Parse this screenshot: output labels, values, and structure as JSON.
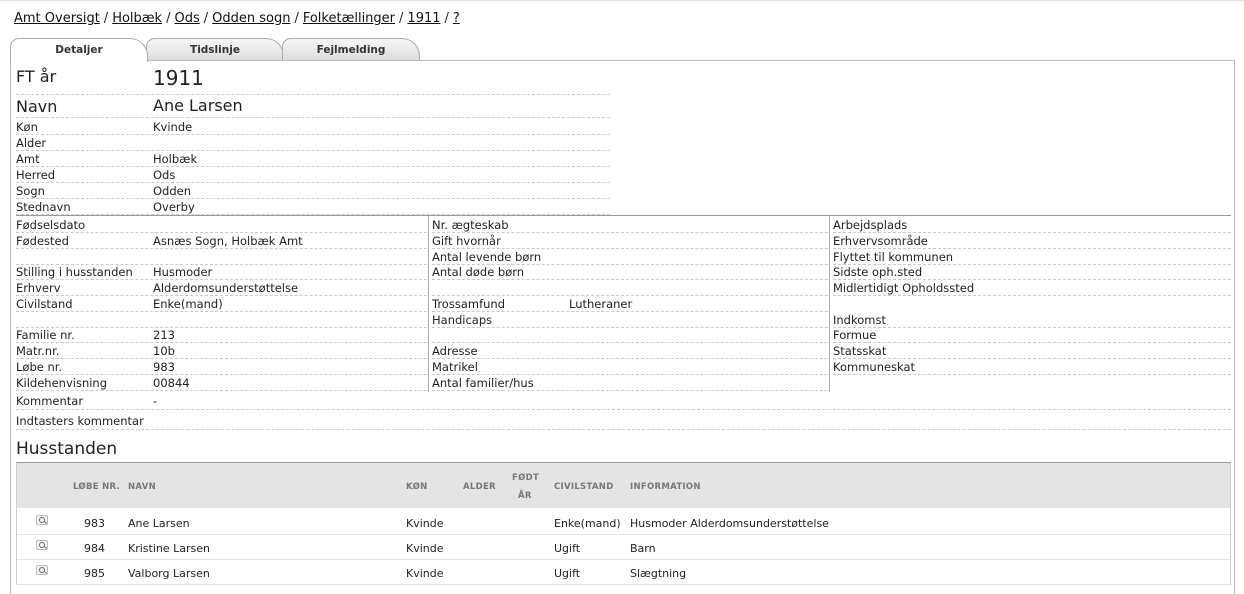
{
  "breadcrumb": {
    "items": [
      "Amt Oversigt",
      "Holbæk",
      "Ods",
      "Odden sogn",
      "Folketællinger",
      "1911",
      "?"
    ]
  },
  "tabs": [
    "Detaljer",
    "Tidslinje",
    "Fejlmelding"
  ],
  "top": {
    "ft_label": "FT år",
    "ft_value": "1911",
    "name_label": "Navn",
    "name_value": "Ane Larsen",
    "rows": [
      {
        "label": "Køn",
        "value": "Kvinde"
      },
      {
        "label": "Alder",
        "value": ""
      },
      {
        "label": "Amt",
        "value": "Holbæk"
      },
      {
        "label": "Herred",
        "value": "Ods"
      },
      {
        "label": "Sogn",
        "value": "Odden"
      },
      {
        "label": "Stednavn",
        "value": "Overby"
      }
    ]
  },
  "col1": [
    {
      "label": "Fødselsdato",
      "value": ""
    },
    {
      "label": "Fødested",
      "value": "Asnæs Sogn, Holbæk Amt"
    },
    {
      "label": "",
      "value": ""
    },
    {
      "label": "Stilling i husstanden",
      "value": "Husmoder"
    },
    {
      "label": "Erhverv",
      "value": "Alderdomsunderstøttelse"
    },
    {
      "label": "Civilstand",
      "value": "Enke(mand)"
    },
    {
      "label": "",
      "value": ""
    },
    {
      "label": "Familie nr.",
      "value": "213"
    },
    {
      "label": "Matr.nr.",
      "value": "10b"
    },
    {
      "label": "Løbe nr.",
      "value": "983"
    },
    {
      "label": "Kildehenvisning",
      "value": "00844"
    }
  ],
  "col2": [
    {
      "label": "Nr. ægteskab",
      "value": ""
    },
    {
      "label": "Gift hvornår",
      "value": ""
    },
    {
      "label": "Antal levende børn",
      "value": ""
    },
    {
      "label": "Antal døde børn",
      "value": ""
    },
    {
      "label": "",
      "value": ""
    },
    {
      "label": "Trossamfund",
      "value": "Lutheraner"
    },
    {
      "label": "Handicaps",
      "value": ""
    },
    {
      "label": "",
      "value": ""
    },
    {
      "label": "Adresse",
      "value": ""
    },
    {
      "label": "Matrikel",
      "value": ""
    },
    {
      "label": "Antal familier/hus",
      "value": ""
    }
  ],
  "col3": [
    {
      "label": "Arbejdsplads"
    },
    {
      "label": "Erhvervsområde"
    },
    {
      "label": "Flyttet til kommunen"
    },
    {
      "label": "Sidste oph.sted"
    },
    {
      "label": "Midlertidigt Opholdssted"
    },
    {
      "label": "Indkomst"
    },
    {
      "label": "Formue"
    },
    {
      "label": "Statsskat"
    },
    {
      "label": "Kommuneskat"
    }
  ],
  "comment": {
    "label": "Kommentar",
    "value": "-"
  },
  "indtaster": {
    "label": "Indtasters kommentar"
  },
  "household": {
    "title": "Husstanden",
    "headers": {
      "lobe": "LØBE NR.",
      "navn": "NAVN",
      "kon": "KØN",
      "alder": "ALDER",
      "fodt1": "FØDT",
      "fodt2": "ÅR",
      "civil": "CIVILSTAND",
      "info": "INFORMATION"
    },
    "rows": [
      {
        "lobe": "983",
        "navn": "Ane Larsen",
        "kon": "Kvinde",
        "civil": "Enke(mand)",
        "info": "Husmoder Alderdomsunderstøttelse"
      },
      {
        "lobe": "984",
        "navn": "Kristine Larsen",
        "kon": "Kvinde",
        "civil": "Ugift",
        "info": "Barn"
      },
      {
        "lobe": "985",
        "navn": "Valborg Larsen",
        "kon": "Kvinde",
        "civil": "Ugift",
        "info": "Slægtning"
      }
    ]
  }
}
